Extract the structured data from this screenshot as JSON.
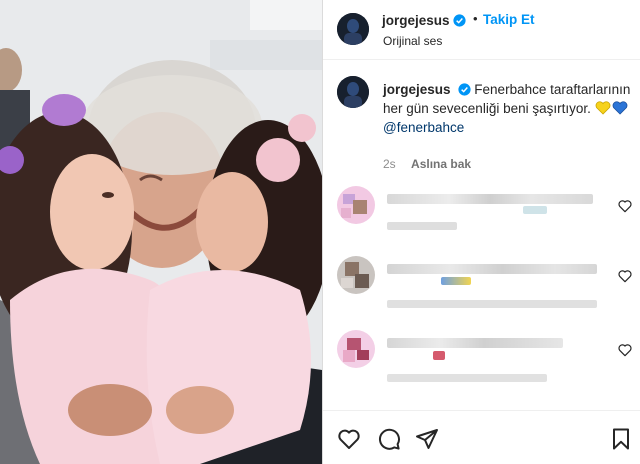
{
  "post": {
    "username": "jorgejesus",
    "follow_label": "Takip Et",
    "separator": "•",
    "audio": "Orijinal ses"
  },
  "caption": {
    "username": "jorgejesus",
    "text": "Fenerbahce taraftarlarının her gün sevecenliği beni şaşırtıyor.",
    "emojis": [
      "yellow-heart",
      "blue-heart"
    ],
    "mention": "@fenerbahce",
    "time": "2s",
    "see_translation": "Aslına bak"
  },
  "colors": {
    "accent": "#0095f6",
    "verified": "#0095f6",
    "mention": "#00376b",
    "muted": "#8e8e8e"
  },
  "icons": [
    "verified-badge-icon",
    "like-icon",
    "comment-icon",
    "share-icon",
    "save-icon"
  ]
}
